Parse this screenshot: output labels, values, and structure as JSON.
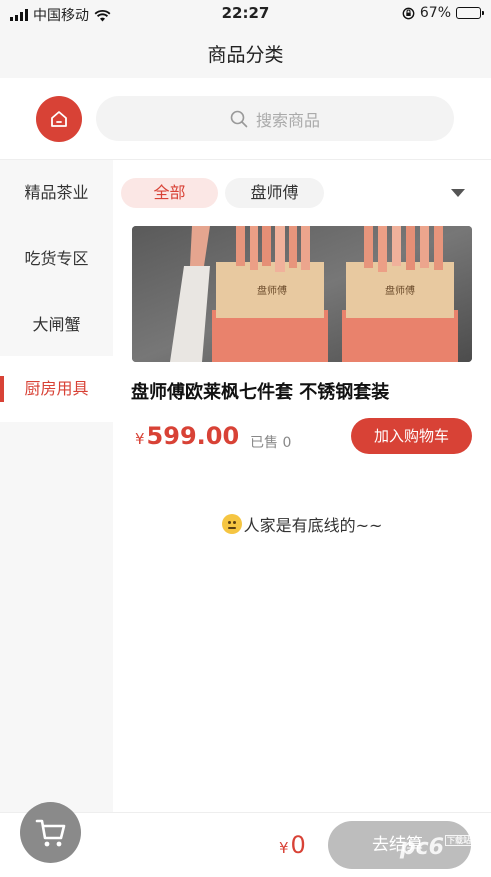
{
  "status_bar": {
    "carrier": "中国移动",
    "time": "22:27",
    "battery": "67%",
    "battery_level": 0.67
  },
  "nav": {
    "title": "商品分类"
  },
  "search": {
    "placeholder": "搜索商品"
  },
  "sidebar": {
    "items": [
      {
        "label": "精品茶业"
      },
      {
        "label": "吃货专区"
      },
      {
        "label": "大闸蟹"
      },
      {
        "label": "厨房用具"
      }
    ],
    "active_index": 3
  },
  "filters": {
    "chips": [
      {
        "label": "全部"
      },
      {
        "label": "盘师傅"
      }
    ]
  },
  "product": {
    "title": "盘师傅欧莱枫七件套 不锈钢套装",
    "currency": "¥",
    "price": "599.00",
    "sold": "已售 0",
    "add_to_cart": "加入购物车",
    "box_logo": "盘师傅"
  },
  "end_message": "人家是有底线的~~",
  "footer": {
    "currency": "¥",
    "total": "0",
    "checkout": "去结算",
    "watermark": "pc6",
    "watermark_tag": "下载站"
  },
  "colors": {
    "accent": "#d84236",
    "accent_light": "#fbe7e5",
    "checkout_disabled": "#bdbdbd",
    "cart_circle": "#8a8a8a"
  },
  "icons": [
    "signal-icon",
    "wifi-icon",
    "lock-rotation-icon",
    "battery-icon",
    "home-icon",
    "search-icon",
    "chevron-down-icon",
    "cart-icon"
  ]
}
